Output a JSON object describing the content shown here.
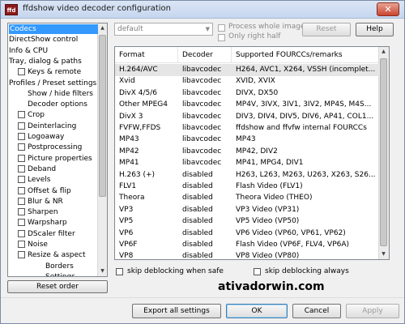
{
  "window": {
    "title": "ffdshow video decoder configuration",
    "icon_text": "ffd"
  },
  "tree": {
    "items": [
      {
        "label": "Codecs",
        "has_checkbox": false,
        "selected": true
      },
      {
        "label": "DirectShow control",
        "has_checkbox": false
      },
      {
        "label": "Info & CPU",
        "has_checkbox": false
      },
      {
        "label": "Tray, dialog & paths",
        "has_checkbox": false
      },
      {
        "label": "Keys & remote",
        "has_checkbox": true
      },
      {
        "label": "Profiles / Preset settings",
        "has_checkbox": false
      },
      {
        "label": "Show / hide filters",
        "has_checkbox": false
      },
      {
        "label": "Decoder options",
        "has_checkbox": false
      },
      {
        "label": "Crop",
        "has_checkbox": true
      },
      {
        "label": "Deinterlacing",
        "has_checkbox": true
      },
      {
        "label": "Logoaway",
        "has_checkbox": true
      },
      {
        "label": "Postprocessing",
        "has_checkbox": true
      },
      {
        "label": "Picture properties",
        "has_checkbox": true
      },
      {
        "label": "Deband",
        "has_checkbox": true
      },
      {
        "label": "Levels",
        "has_checkbox": true
      },
      {
        "label": "Offset & flip",
        "has_checkbox": true
      },
      {
        "label": "Blur & NR",
        "has_checkbox": true
      },
      {
        "label": "Sharpen",
        "has_checkbox": true
      },
      {
        "label": "Warpsharp",
        "has_checkbox": true
      },
      {
        "label": "DScaler filter",
        "has_checkbox": true
      },
      {
        "label": "Noise",
        "has_checkbox": true
      },
      {
        "label": "Resize & aspect",
        "has_checkbox": true
      },
      {
        "label": "Borders",
        "has_checkbox": false
      },
      {
        "label": "Settings",
        "has_checkbox": false
      }
    ],
    "reset_order_label": "Reset order"
  },
  "preset": {
    "selected": "default",
    "process_whole_image": "Process whole image",
    "only_right_half": "Only right half",
    "reset_label": "Reset",
    "help_label": "Help"
  },
  "codec_table": {
    "columns": [
      "Format",
      "Decoder",
      "Supported FOURCCs/remarks"
    ],
    "rows": [
      [
        "H.264/AVC",
        "libavcodec",
        "H264, AVC1, X264, VSSH (incomplet..."
      ],
      [
        "Xvid",
        "libavcodec",
        "XVID, XVIX"
      ],
      [
        "DivX 4/5/6",
        "libavcodec",
        "DIVX, DX50"
      ],
      [
        "Other MPEG4",
        "libavcodec",
        "MP4V, 3IVX, 3IV1, 3IV2, MP4S, M4S..."
      ],
      [
        "DivX 3",
        "libavcodec",
        "DIV3, DIV4, DIV5, DIV6, AP41, COL1..."
      ],
      [
        "FVFW,FFDS",
        "libavcodec",
        "ffdshow and ffvfw internal FOURCCs"
      ],
      [
        "MP43",
        "libavcodec",
        "MP43"
      ],
      [
        "MP42",
        "libavcodec",
        "MP42, DIV2"
      ],
      [
        "MP41",
        "libavcodec",
        "MP41, MPG4, DIV1"
      ],
      [
        "H.263 (+)",
        "disabled",
        "H263, L263, M263, U263, X263, S26..."
      ],
      [
        "FLV1",
        "disabled",
        "Flash Video (FLV1)"
      ],
      [
        "Theora",
        "disabled",
        "Theora Video (THEO)"
      ],
      [
        "VP3",
        "disabled",
        "VP3 Video (VP31)"
      ],
      [
        "VP5",
        "disabled",
        "VP5 Video (VP50)"
      ],
      [
        "VP6",
        "disabled",
        "VP6 Video (VP60, VP61, VP62)"
      ],
      [
        "VP6F",
        "disabled",
        "Flash Video (VP6F, FLV4, VP6A)"
      ],
      [
        "VP8",
        "disabled",
        "VP8 Video (VP80)"
      ]
    ],
    "selected_row": 0
  },
  "options": {
    "skip_deblocking_when_safe": "skip deblocking when safe",
    "skip_deblocking_always": "skip deblocking always"
  },
  "watermark": "ativadorwin.com",
  "buttons": {
    "export": "Export all settings",
    "ok": "OK",
    "cancel": "Cancel",
    "apply": "Apply"
  },
  "colors": {
    "selection": "#3399ff",
    "close_button": "#c9452f"
  }
}
